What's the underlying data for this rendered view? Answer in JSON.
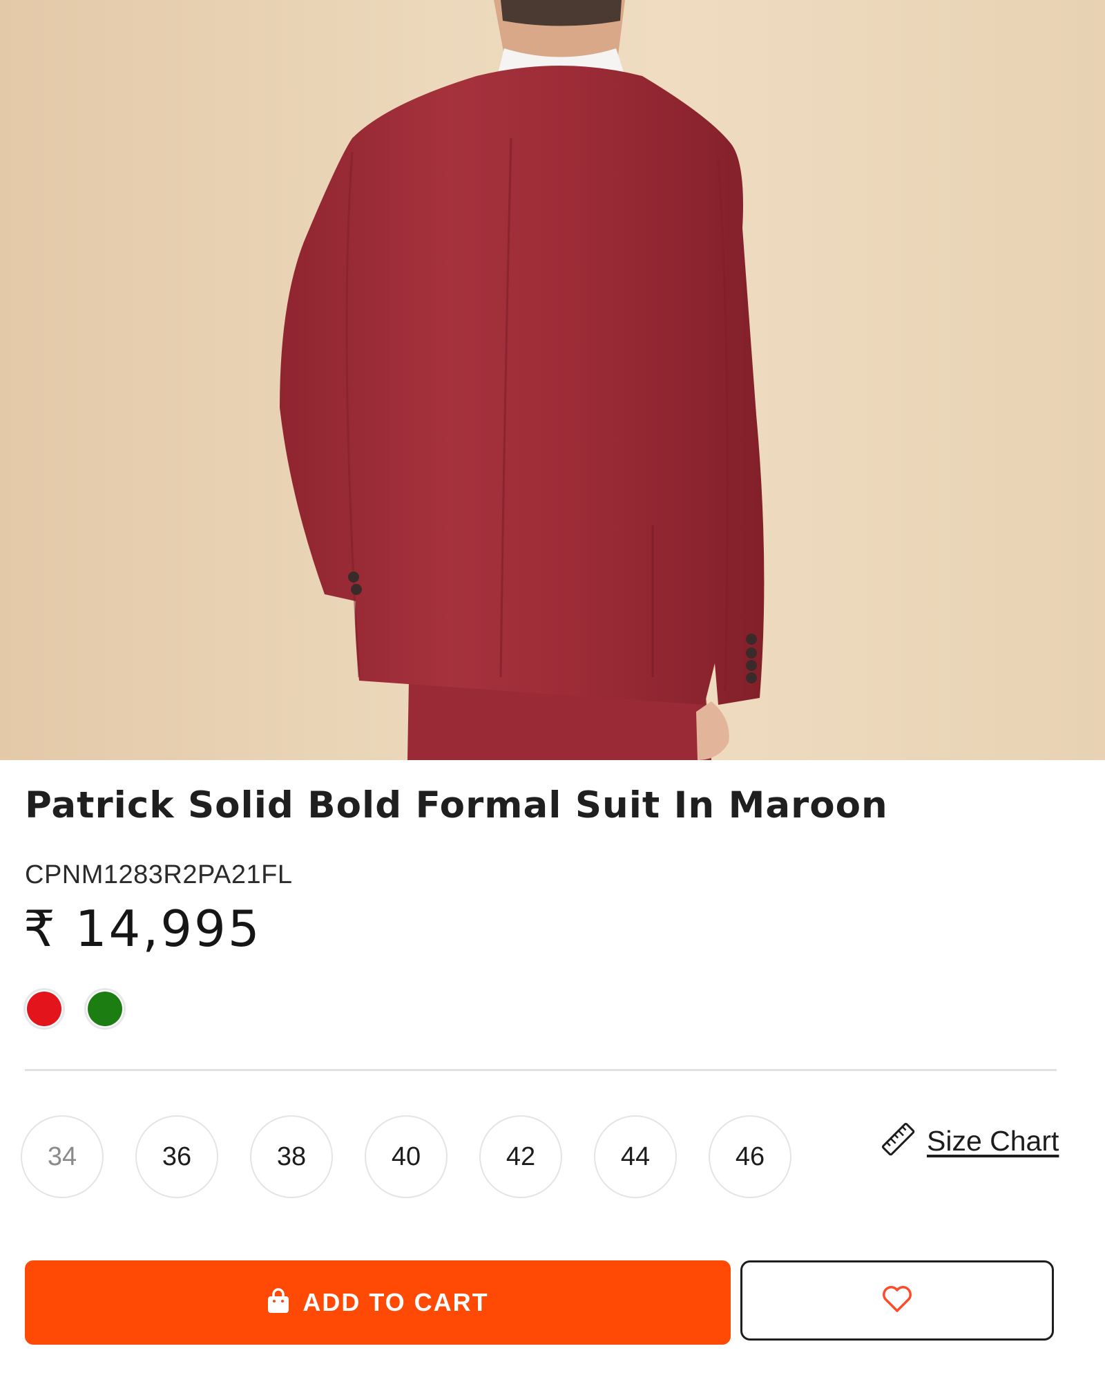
{
  "product": {
    "image_alt": "Back view of model wearing maroon suit",
    "title": "Patrick Solid Bold Formal Suit In Maroon",
    "sku": "CPNM1283R2PA21FL",
    "price": "₹ 14,995"
  },
  "colors": [
    {
      "name": "red",
      "hex": "#e3141c"
    },
    {
      "name": "green",
      "hex": "#1c7e12"
    }
  ],
  "sizes": [
    {
      "label": "34",
      "available": false
    },
    {
      "label": "36",
      "available": true
    },
    {
      "label": "38",
      "available": true
    },
    {
      "label": "40",
      "available": true
    },
    {
      "label": "42",
      "available": true
    },
    {
      "label": "44",
      "available": true
    },
    {
      "label": "46",
      "available": true
    }
  ],
  "size_chart": {
    "label": "Size Chart",
    "icon": "ruler-icon"
  },
  "actions": {
    "add_to_cart_label": "ADD TO CART",
    "add_to_cart_icon": "shopping-bag-icon",
    "wishlist_icon": "heart-icon",
    "accent_color": "#ff4a06"
  }
}
